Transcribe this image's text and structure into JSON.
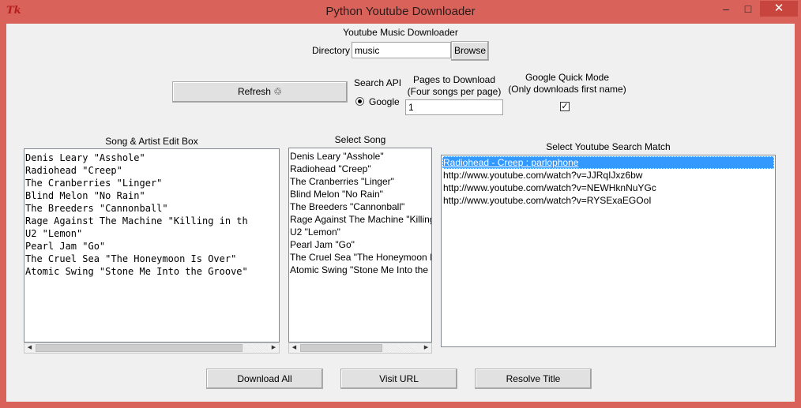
{
  "window": {
    "title": "Python Youtube Downloader",
    "icon": "tk-feather-icon",
    "controls": {
      "minimize": "–",
      "maximize": "□",
      "close": "✕"
    }
  },
  "header": {
    "title": "Youtube Music Downloader",
    "directory_label": "Directory",
    "directory_value": "music",
    "browse_label": "Browse"
  },
  "controls": {
    "refresh_label": "Refresh ♲",
    "search_api_label": "Search API",
    "radio_google_label": "Google",
    "pages_label_line1": "Pages to Download",
    "pages_label_line2": "(Four songs per page)",
    "pages_value": "1",
    "quick_label_line1": "Google Quick Mode",
    "quick_label_line2": "(Only downloads first name)",
    "quick_checked_mark": "✓"
  },
  "edit_box": {
    "title": "Song & Artist Edit Box",
    "lines": [
      "Denis Leary  \"Asshole\"",
      "Radiohead  \"Creep\"",
      "The Cranberries  \"Linger\"",
      "Blind Melon  \"No Rain\"",
      "The Breeders  \"Cannonball\"",
      "Rage Against The Machine  \"Killing in th",
      "U2  \"Lemon\"",
      "Pearl Jam  \"Go\"",
      "The Cruel Sea  \"The Honeymoon Is Over\"",
      "Atomic Swing  \"Stone Me Into the Groove\""
    ]
  },
  "select_song": {
    "title": "Select Song",
    "items": [
      "Denis Leary  \"Asshole\"",
      "Radiohead  \"Creep\"",
      "The Cranberries  \"Linger\"",
      "Blind Melon  \"No Rain\"",
      "The Breeders  \"Cannonball\"",
      "Rage Against The Machine  \"Killing",
      "U2  \"Lemon\"",
      "Pearl Jam  \"Go\"",
      "The Cruel Sea  \"The Honeymoon I",
      "Atomic Swing  \"Stone Me Into the"
    ]
  },
  "search_match": {
    "title": "Select Youtube Search Match",
    "items": [
      "Radiohead - Creep : parlophone",
      "http://www.youtube.com/watch?v=JJRqIJxz6bw",
      "http://www.youtube.com/watch?v=NEWHknNuYGc",
      "http://www.youtube.com/watch?v=RYSExaEGOoI"
    ]
  },
  "footer": {
    "download_all_label": "Download All",
    "visit_url_label": "Visit URL",
    "resolve_title_label": "Resolve Title"
  },
  "scroll": {
    "left_arrow": "◀",
    "right_arrow": "▶"
  },
  "colors": {
    "window_frame": "#d9635a",
    "client_bg": "#f0f0f0",
    "selection": "#3399ff",
    "close_button": "#c7453d"
  }
}
